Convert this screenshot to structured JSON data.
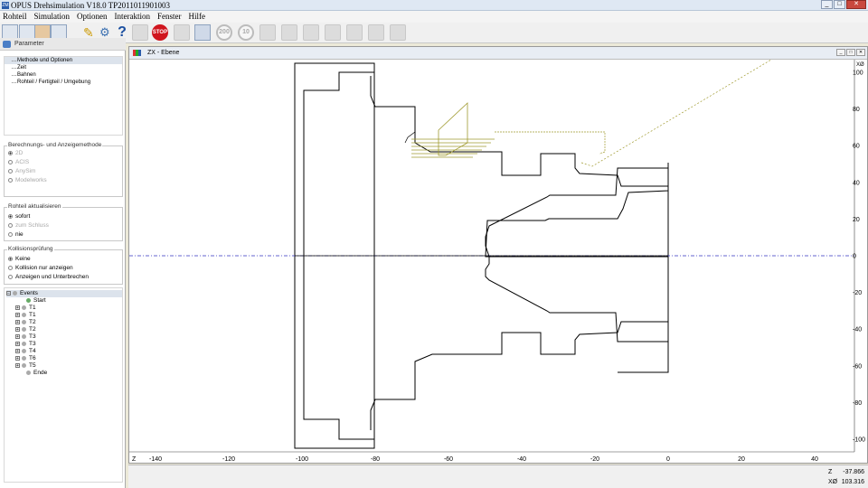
{
  "window": {
    "title": "OPUS Drehsimulation V18.0  TP2011011901003",
    "app_badge": "ZM"
  },
  "menu": [
    "Rohteil",
    "Simulation",
    "Optionen",
    "Interaktion",
    "Fenster",
    "Hilfe"
  ],
  "toolbar": {
    "stop_label": "STOP",
    "speed_200": "200",
    "speed_10": "10",
    "help_glyph": "?"
  },
  "left_panel": {
    "header": "Parameter",
    "tree": [
      "Methode und Optionen",
      "Zeit",
      "Bahnen",
      "Rohteil / Fertigteil / Umgebung"
    ],
    "method_group": {
      "title": "Berechnungs- und Anzeigemethode",
      "options": [
        "2D",
        "ACIS",
        "AnySim",
        "Modelworks"
      ]
    },
    "update_group": {
      "title": "Rohteil aktualisieren",
      "options": [
        "sofort",
        "zum Schluss",
        "nie"
      ],
      "selected": "sofort"
    },
    "collision_group": {
      "title": "Kollisionsprüfung",
      "options": [
        "Keine",
        "Kollision nur anzeigen",
        "Anzeigen und Unterbrechen"
      ],
      "selected": "Keine"
    },
    "events": {
      "root": "Events",
      "items": [
        "Start",
        "T1",
        "T1",
        "T2",
        "T2",
        "T3",
        "T3",
        "T4",
        "T6",
        "T5",
        "Ende"
      ]
    }
  },
  "view": {
    "title": "ZX - Ebene",
    "x_axis": {
      "label": "Z",
      "ticks": [
        "-140",
        "-120",
        "-100",
        "-80",
        "-60",
        "-40",
        "-20",
        "0",
        "20",
        "40"
      ]
    },
    "y_axis": {
      "label": "XØ",
      "ticks": [
        "100",
        "80",
        "60",
        "40",
        "20",
        "0",
        "-20",
        "-40",
        "-60",
        "-80",
        "-100"
      ]
    },
    "colors": {
      "outline": "#000000",
      "axis": "#3030c0",
      "toolpath": "#a09a30"
    }
  },
  "status": {
    "z_label": "Z",
    "z_value": "-37.866",
    "x_label": "XØ",
    "x_value": "103.316"
  }
}
